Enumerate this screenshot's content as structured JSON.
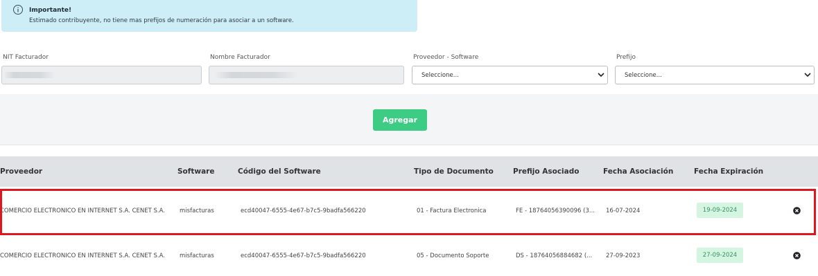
{
  "alert": {
    "title": "Importante!",
    "message": "Estimado contribuyente, no tiene mas prefijos de numeración para asociar a un software.",
    "icon": "info-circle-icon"
  },
  "form": {
    "nit_label": "NIT Facturador",
    "nombre_label": "Nombre Facturador",
    "proveedor_label": "Proveedor - Software",
    "proveedor_value": "Seleccione...",
    "prefijo_label": "Prefijo",
    "prefijo_value": "Seleccione..."
  },
  "actions": {
    "add_label": "Agregar",
    "add_color": "#3ccc84"
  },
  "table": {
    "headers": [
      "Proveedor",
      "Software",
      "Código del Software",
      "Tipo de Documento",
      "Prefijo Asociado",
      "Fecha Asociación",
      "Fecha Expiración"
    ],
    "rows": [
      {
        "proveedor": "COMERCIO ELECTRONICO EN INTERNET S.A. CENET S.A.",
        "software": "misfacturas",
        "codigo": "ecd40047-6555-4e67-b7c5-9badfa566220",
        "tipo": "01 - Factura Electronica",
        "prefijo": "FE - 18764056390096 (3...",
        "fecha_asociacion": "16-07-2024",
        "fecha_expiracion": "19-09-2024"
      },
      {
        "proveedor": "COMERCIO ELECTRONICO EN INTERNET S.A. CENET S.A.",
        "software": "misfacturas",
        "codigo": "ecd40047-6555-4e67-b7c5-9badfa566220",
        "tipo": "05 - Documento Soporte",
        "prefijo": "DS - 18764056884682 (...",
        "fecha_asociacion": "27-09-2023",
        "fecha_expiracion": "27-09-2024"
      }
    ]
  },
  "colors": {
    "alert_bg": "#cdeef6",
    "highlight": "#e0151d",
    "badge_bg": "#d5f5e3"
  }
}
